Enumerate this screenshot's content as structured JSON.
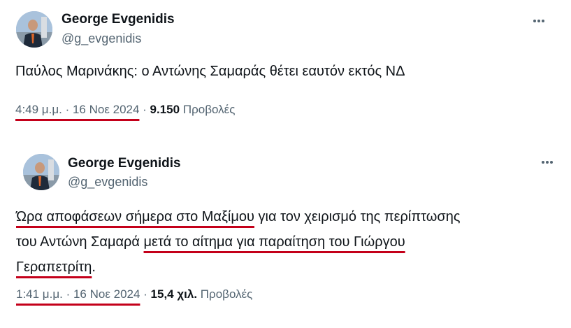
{
  "tweets": [
    {
      "author": {
        "name": "George Evgenidis",
        "handle": "@g_evgenidis",
        "avatar_icon": "user-avatar-icon"
      },
      "more_icon": "more-options-icon",
      "text_lines": [
        {
          "segments": [
            {
              "text": "Παύλος Μαρινάκης: ο Αντώνης Σαμαράς θέτει εαυτόν εκτός ΝΔ",
              "underlined": false
            }
          ]
        }
      ],
      "timestamp": "4:49 μ.μ. · 16 Νοε 2024",
      "separator": " · ",
      "views_count": "9.150",
      "views_label": "Προβολές"
    },
    {
      "author": {
        "name": "George Evgenidis",
        "handle": "@g_evgenidis",
        "avatar_icon": "user-avatar-icon"
      },
      "more_icon": "more-options-icon",
      "text_lines": [
        {
          "segments": [
            {
              "text": "Ώρα αποφάσεων σήμερα στο Μαξίμου",
              "underlined": true
            },
            {
              "text": " για τον χειρισμό της περίπτωσης",
              "underlined": false
            }
          ]
        },
        {
          "segments": [
            {
              "text": "του Αντώνη Σαμαρά ",
              "underlined": false
            },
            {
              "text": "μετά το αίτημα για παραίτηση του Γιώργου",
              "underlined": true
            }
          ]
        },
        {
          "segments": [
            {
              "text": "Γεραπετρίτη",
              "underlined": true
            },
            {
              "text": ".",
              "underlined": false
            }
          ]
        }
      ],
      "timestamp": "1:41 μ.μ. · 16 Νοε 2024",
      "separator": " · ",
      "views_count": "15,4 χιλ.",
      "views_label": "Προβολές"
    }
  ],
  "colors": {
    "text_primary": "#0f1419",
    "text_secondary": "#536471",
    "annotation_underline": "#c4001a"
  }
}
